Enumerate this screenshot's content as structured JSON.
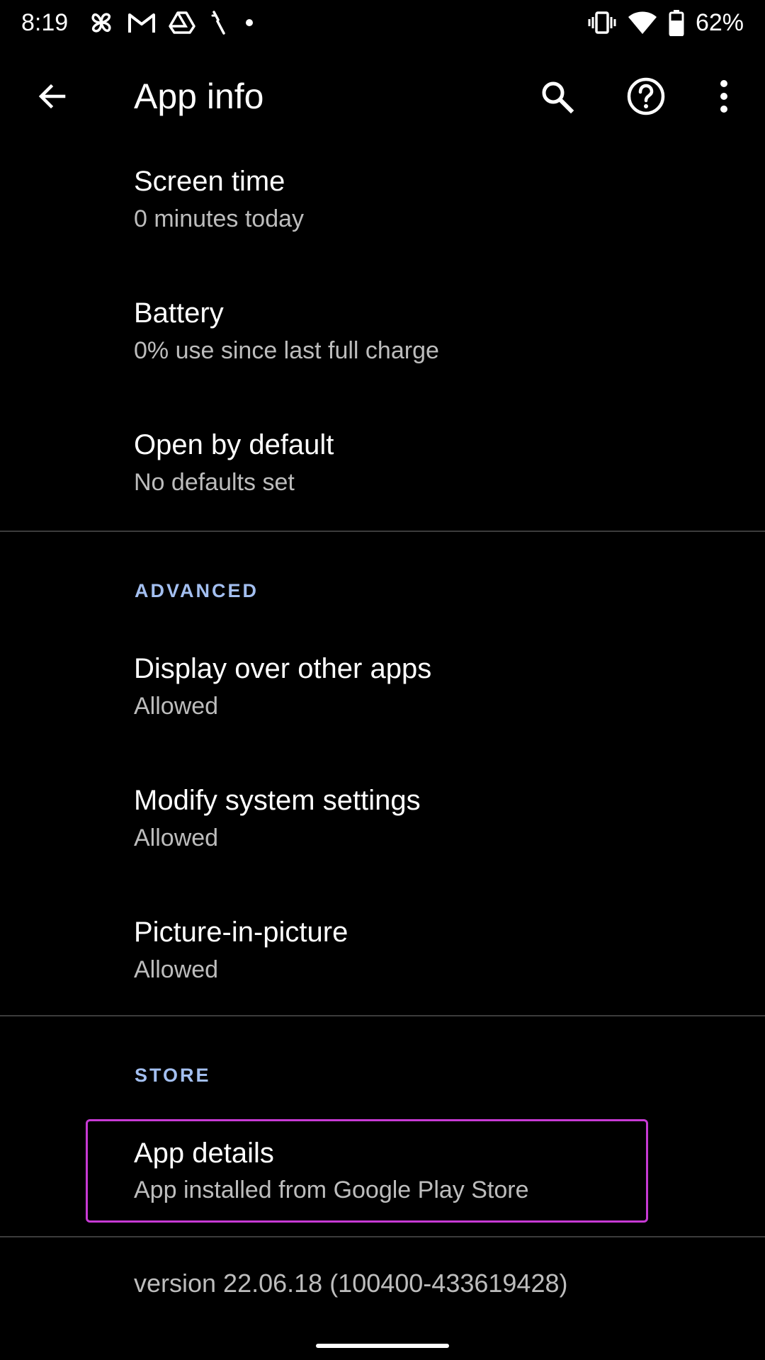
{
  "status_bar": {
    "time": "8:19",
    "notification_icons": [
      "pinwheel-icon",
      "gmail-icon",
      "drive-icon",
      "feather-icon",
      "dot-icon"
    ],
    "system_icons": [
      "vibrate-icon",
      "wifi-icon",
      "battery-icon"
    ],
    "battery_percent": "62%"
  },
  "toolbar": {
    "title": "App info",
    "actions": [
      "back-icon",
      "search-icon",
      "help-icon",
      "more-vert-icon"
    ]
  },
  "items": {
    "screen_time": {
      "title": "Screen time",
      "summary": "0 minutes today"
    },
    "battery": {
      "title": "Battery",
      "summary": "0% use since last full charge"
    },
    "open_by_default": {
      "title": "Open by default",
      "summary": "No defaults set"
    },
    "display_over": {
      "title": "Display over other apps",
      "summary": "Allowed"
    },
    "modify_system": {
      "title": "Modify system settings",
      "summary": "Allowed"
    },
    "pip": {
      "title": "Picture-in-picture",
      "summary": "Allowed"
    },
    "app_details": {
      "title": "App details",
      "summary": "App installed from Google Play Store"
    }
  },
  "sections": {
    "advanced": "ADVANCED",
    "store": "STORE"
  },
  "version": "version 22.06.18 (100400-433619428)",
  "colors": {
    "background": "#000000",
    "accent": "#a3bff0",
    "highlight": "#c73ad4",
    "primary_text": "#ffffff",
    "secondary_text": "#bdbdbd"
  }
}
